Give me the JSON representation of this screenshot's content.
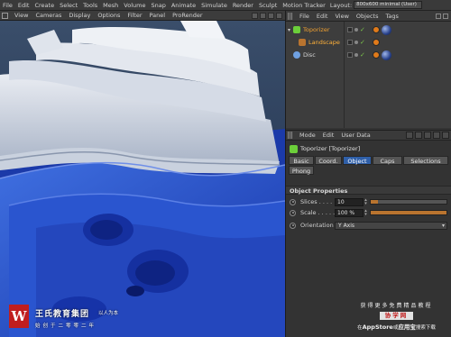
{
  "menubar": {
    "items": [
      "File",
      "Edit",
      "Create",
      "Select",
      "Tools",
      "Mesh",
      "Volume",
      "Snap",
      "Animate",
      "Simulate",
      "Render",
      "Sculpt",
      "Motion Tracker"
    ],
    "layout_label": "Layout:",
    "layout_value": "800x600 minimal (User)"
  },
  "viewport": {
    "menu": [
      "View",
      "Cameras",
      "Display",
      "Options",
      "Filter",
      "Panel",
      "ProRender"
    ]
  },
  "object_manager": {
    "menu": [
      "File",
      "Edit",
      "View",
      "Objects",
      "Tags"
    ],
    "objects": [
      {
        "name": "Toporizer",
        "state": "active",
        "icon_color": "#6ccf3a",
        "tags": [
          "orange",
          "ball"
        ]
      },
      {
        "name": "Landscape",
        "state": "selected-child",
        "icon_color": "#b9742f",
        "tags": [
          "orange"
        ]
      },
      {
        "name": "Disc",
        "state": "normal",
        "icon_color": "#6fa0e0",
        "tags": [
          "orange",
          "ball"
        ]
      }
    ]
  },
  "attribute_manager": {
    "menu": [
      "Mode",
      "Edit",
      "User Data"
    ],
    "title": "Toporizer [Toporizer]",
    "tabs": [
      "Basic",
      "Coord.",
      "Object",
      "Caps",
      "Selections",
      "Phong"
    ],
    "active_tab": "Object",
    "section": "Object Properties",
    "props": {
      "slices_label": "Slices . . . .",
      "slices_value": "10",
      "slices_fraction": 0.1,
      "scale_label": "Scale . . . . .",
      "scale_value": "100 %",
      "scale_fraction": 1.0,
      "orientation_label": "Orientation",
      "orientation_value": "Y Axis"
    }
  },
  "watermark_left": {
    "logo": "W",
    "name": "王氏教育集团",
    "motto": "以人为本",
    "slogan": "始创于二零零二年"
  },
  "watermark_right": {
    "line1": "获得更多免费精品教程",
    "badge": "协学网",
    "line3_prefix": "在",
    "line3_store": "AppStore",
    "line3_mid": "或",
    "line3_app": "应用宝",
    "line3_suffix": "搜索下载"
  },
  "colors": {
    "accent_tab": "#2f5fa8",
    "active_object": "#f0a030",
    "slider_fill": "#b9742f"
  }
}
